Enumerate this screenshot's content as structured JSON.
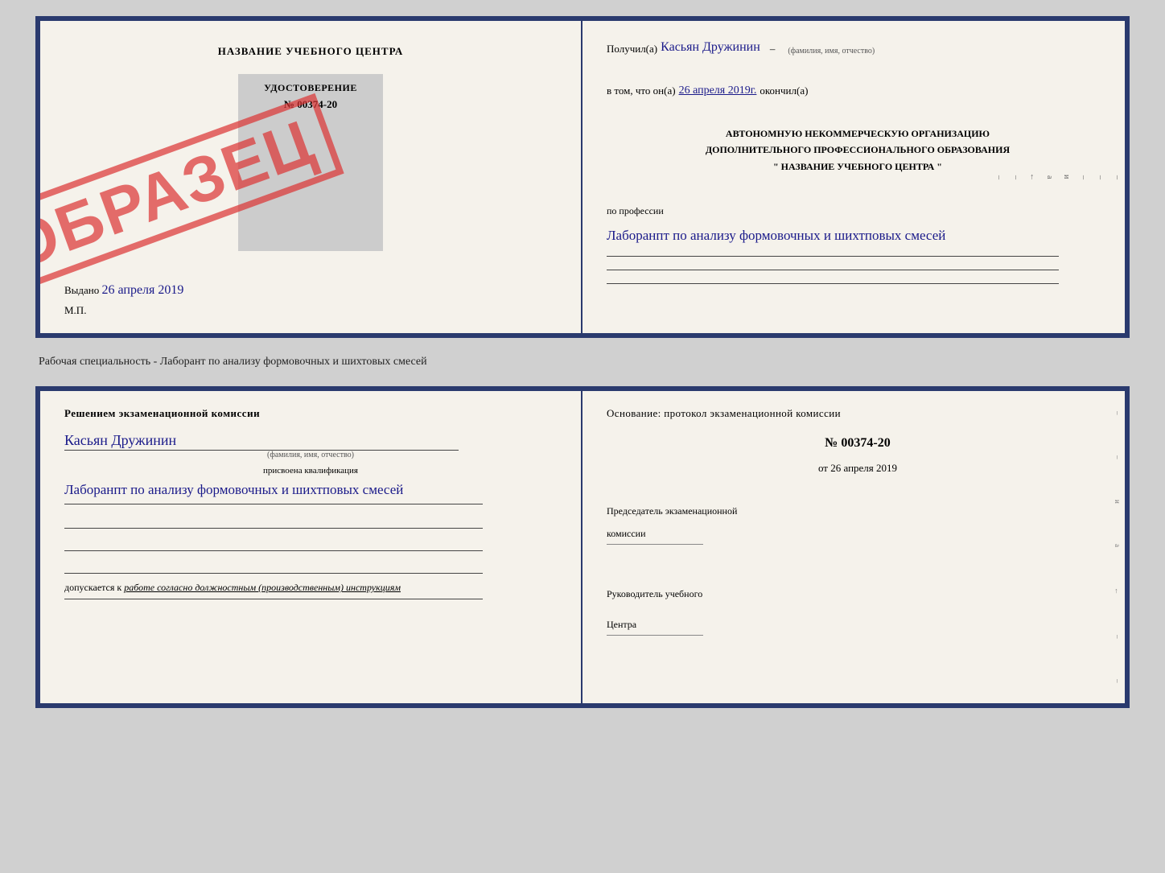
{
  "top_doc": {
    "left": {
      "title": "НАЗВАНИЕ УЧЕБНОГО ЦЕНТРА",
      "cert_label": "УДОСТОВЕРЕНИЕ",
      "cert_number": "№ 00374-20",
      "stamp": "ОБРАЗЕЦ",
      "vydano_label": "Выдано",
      "vydano_date": "26 апреля 2019",
      "mp": "М.П."
    },
    "right": {
      "poluchil_label": "Получил(a)",
      "recipient_name": "Касьян Дружинин",
      "fio_sublabel": "(фамилия, имя, отчество)",
      "vtom_label": "в том, что он(а)",
      "vtom_date": "26 апреля 2019г.",
      "okonchil": "окончил(а)",
      "org_line1": "АВТОНОМНУЮ НЕКОММЕРЧЕСКУЮ ОРГАНИЗАЦИЮ",
      "org_line2": "ДОПОЛНИТЕЛЬНОГО ПРОФЕССИОНАЛЬНОГО ОБРАЗОВАНИЯ",
      "org_line3": "\"  НАЗВАНИЕ УЧЕБНОГО ЦЕНТРА  \"",
      "profession_label": "по профессии",
      "profession_text": "Лаборанпт по анализу формовочных и шихтповых смесей",
      "right_marks": [
        "–",
        "–",
        "–",
        "–",
        "и",
        "а",
        "←",
        "–",
        "–",
        "–"
      ]
    }
  },
  "specialty_text": "Рабочая специальность - Лаборант по анализу формовочных и шихтовых смесей",
  "bottom_doc": {
    "left": {
      "komissia_title": "Решением  экзаменационной  комиссии",
      "name": "Касьян  Дружинин",
      "fio_sublabel": "(фамилия, имя, отчество)",
      "kvali_label": "присвоена квалификация",
      "kvali_text": "Лаборанпт по анализу формовочных и шихтповых смесей",
      "dopuskaetsya_label": "допускается к",
      "dopuskaetsya_text": "работе согласно должностным (производственным) инструкциям"
    },
    "right": {
      "osnov_label": "Основание: протокол экзаменационной  комиссии",
      "protocol_number": "№  00374-20",
      "ot_label": "от",
      "ot_date": "26 апреля 2019",
      "chairman_label1": "Председатель экзаменационной",
      "chairman_label2": "комиссии",
      "rukov_label1": "Руководитель учебного",
      "rukov_label2": "Центра",
      "right_marks": [
        "–",
        "–",
        "–",
        "и",
        "а",
        "←",
        "–",
        "–",
        "–"
      ]
    }
  }
}
